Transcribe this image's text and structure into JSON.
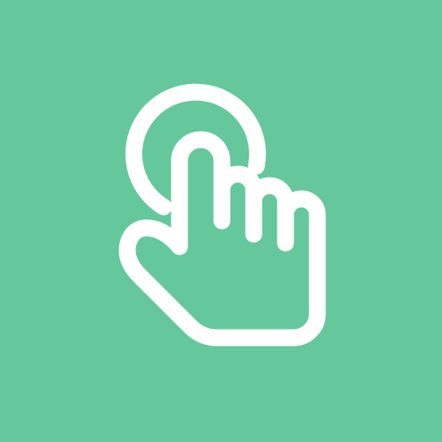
{
  "icon": {
    "name": "tap-gesture-icon",
    "description_semantic": "hand-pointer-with-tap-ripple",
    "background_color": "#64c89c",
    "foreground_color": "#ffffff"
  }
}
